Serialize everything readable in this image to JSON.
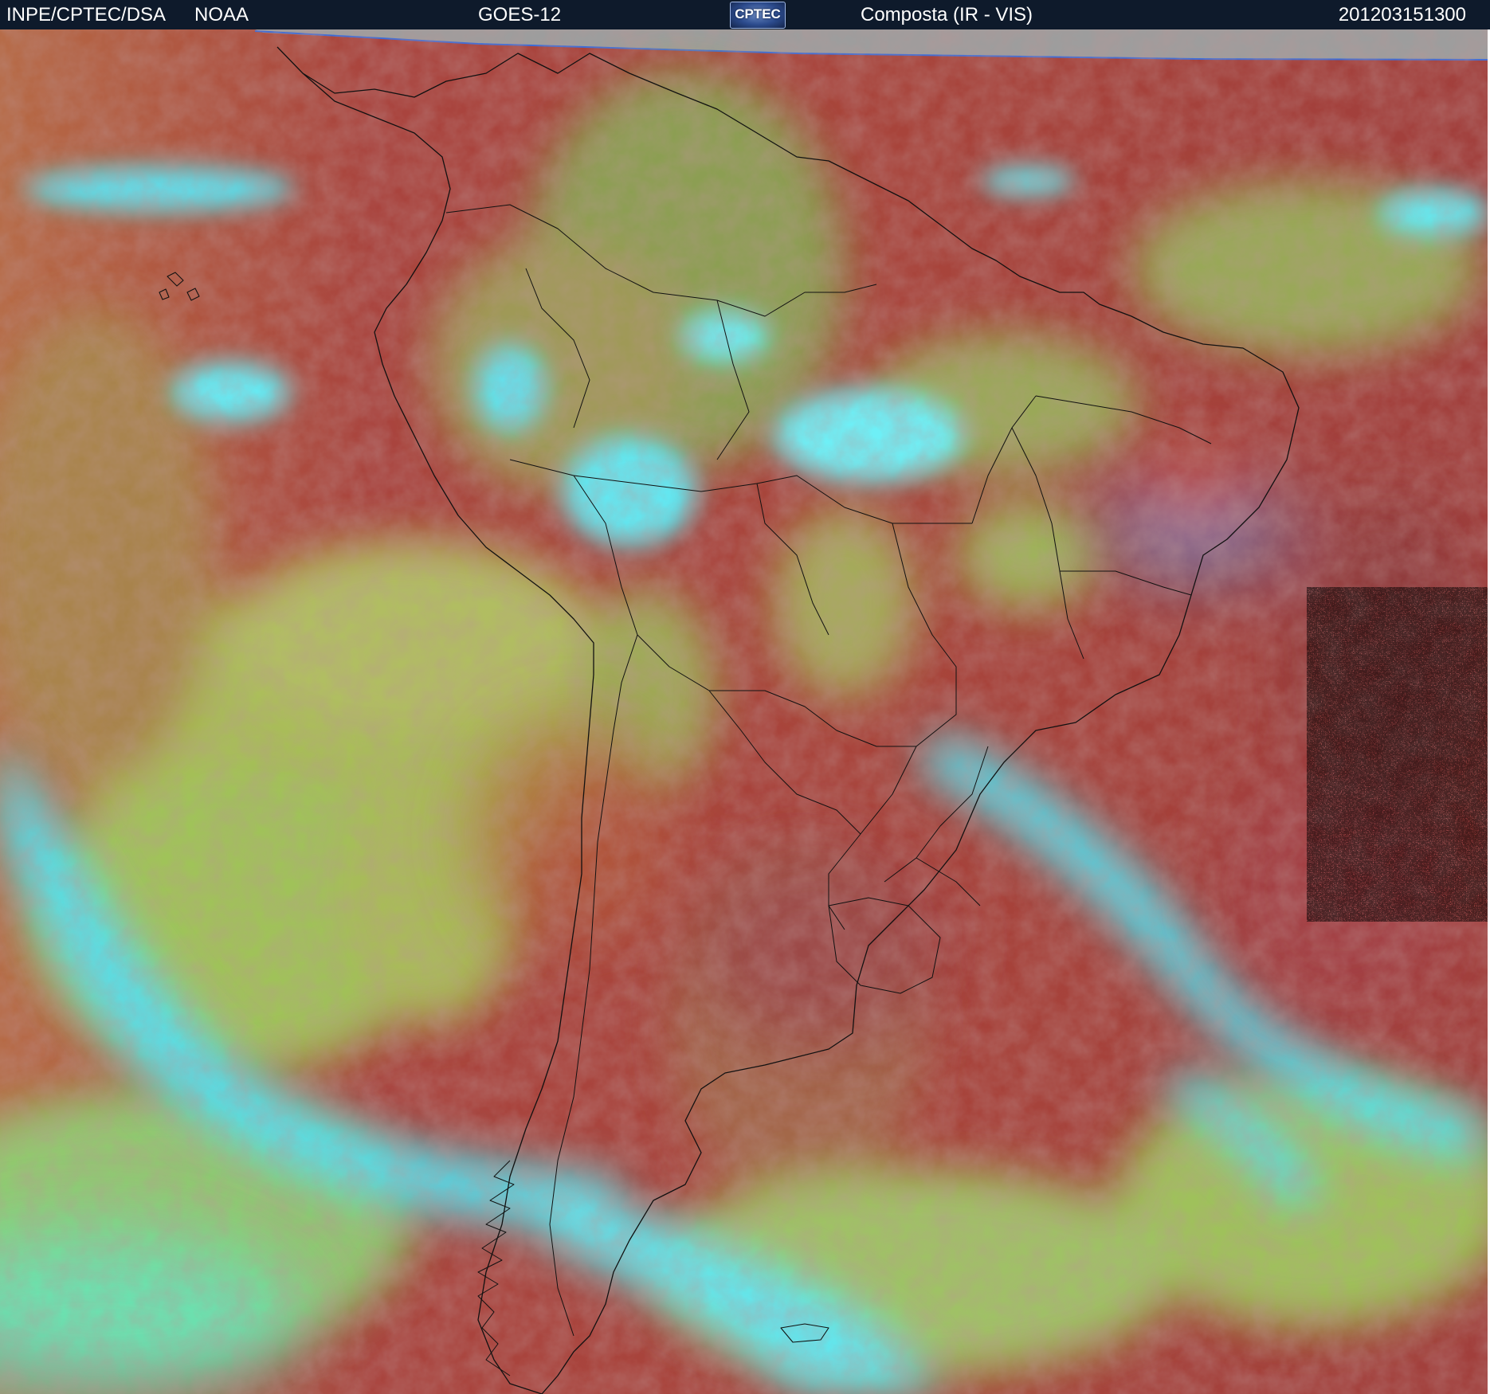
{
  "header": {
    "agency": "INPE/CPTEC/DSA",
    "source": "NOAA",
    "satellite": "GOES-12",
    "logo_text": "CPTEC",
    "product": "Composta (IR - VIS)",
    "timestamp": "201203151300"
  },
  "colors": {
    "header_bg": "#0e1a2b",
    "dry_surface": "#b0413b",
    "mid_cloud": "#9ed35a",
    "high_cloud": "#52f0f5",
    "no_data": "#9d9d9d",
    "coastline": "#111111"
  },
  "icons": {
    "logo": "cptec-logo"
  }
}
